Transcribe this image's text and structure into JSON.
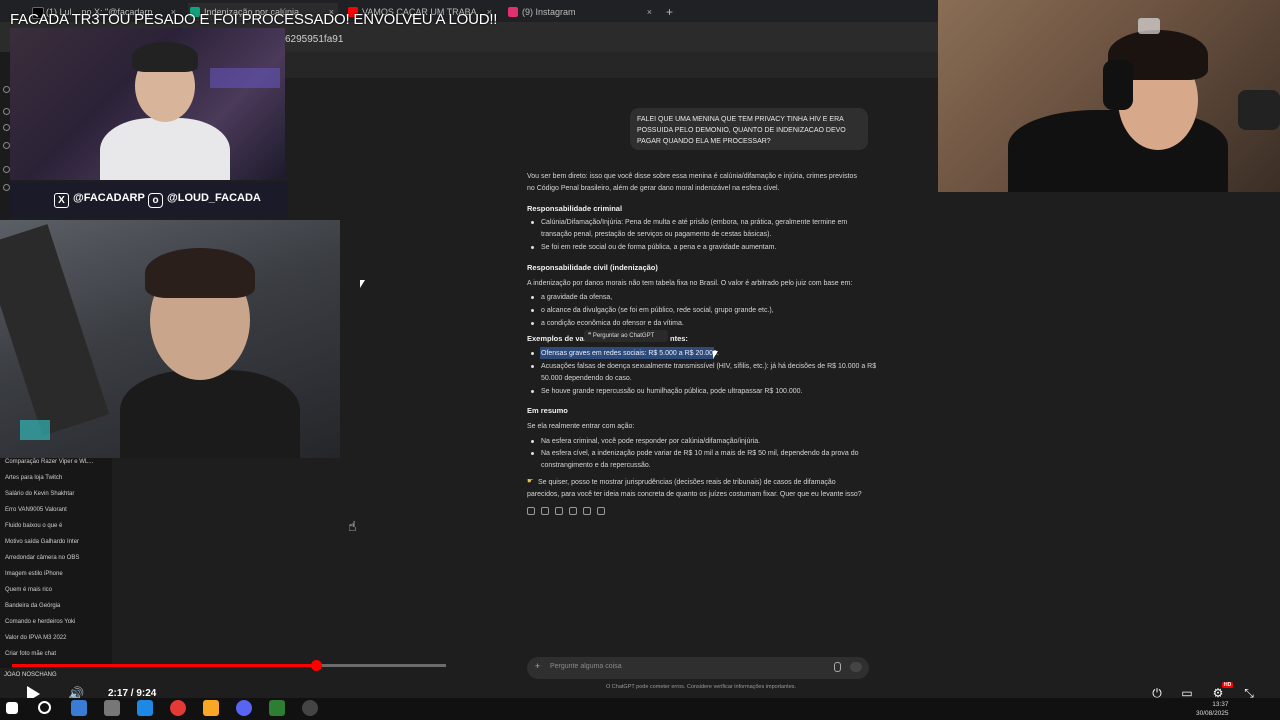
{
  "video": {
    "title": "FACADA TR3TOU PESADO E FOI PROCESSADO! ENVOLVEU A LOUD!!",
    "time": "2:17 / 9:24",
    "progress": 0.7,
    "hd_badge": "HD",
    "viewer_name": "JOAO NOSCHANG"
  },
  "browser": {
    "tabs": [
      {
        "label": "(1) Lul... no X: \"@facadarp",
        "color": "#000000"
      },
      {
        "label": "Indenização por calúnia",
        "color": "#10a37f"
      },
      {
        "label": "VAMOS CAÇAR UM TRABA",
        "color": "#ff0000"
      },
      {
        "label": "(9) Instagram",
        "color": "#e1306c"
      }
    ],
    "url_fragment": "6295951fa91"
  },
  "social": {
    "x_handle": "@FACADARP",
    "ig_handle": "@LOUD_FACADA"
  },
  "sidebar": {
    "history": [
      "Comparação Razer Viper e WL...",
      "Artes para loja Twitch",
      "Salário do Kevin Shakhtar",
      "Erro VAN9005 Valorant",
      "Fluido baixou o que é",
      "Motivo saída Galhardo Inter",
      "Arredondar câmera no OBS",
      "Imagem estilo iPhone",
      "Quem é mais rico",
      "Bandeira da Geórgia",
      "Comando e herdeiros Yoki",
      "Valor do IPVA M3 2022",
      "Criar foto mãe chat"
    ]
  },
  "chat": {
    "user_question": "FALEI QUE UMA MENINA QUE TEM PRIVACY TINHA HIV E ERA POSSUIDA PELO DEMONIO, QUANTO DE INDENIZACAO DEVO PAGAR QUANDO ELA ME PROCESSAR?",
    "intro_1": "Vou ser bem direto: isso que você disse sobre essa menina é calúnia/difamação e injúria, crimes previstos",
    "intro_2": "no Código Penal brasileiro, além de gerar dano moral indenizável na esfera cível.",
    "h_criminal": "Responsabilidade criminal",
    "crim_1a": "Calúnia/Difamação/Injúria: Pena de multa e até prisão (embora, na prática, geralmente termine em",
    "crim_1b": "transação penal, prestação de serviços ou pagamento de cestas básicas).",
    "crim_2": "Se foi em rede social ou de forma pública, a pena e a gravidade aumentam.",
    "h_civil": "Responsabilidade civil (indenização)",
    "civil_intro": "A indenização por danos morais não tem tabela fixa no Brasil. O valor é arbitrado pelo juiz com base em:",
    "civil_1": "a gravidade da ofensa,",
    "civil_2": "o alcance da divulgação (se foi em público, rede social, grupo grande etc.),",
    "civil_3": "a condição econômica do ofensor e da vítima.",
    "h_examples": "Exemplos de valo",
    "h_examples_end": "ntes:",
    "tooltip": "❞  Perguntar ao ChatGPT",
    "ex_1": "Ofensas graves em redes sociais: R$ 5.000 a R$ 20.000.",
    "ex_2a": "Acusações falsas de doença sexualmente transmissível (HIV, sífilis, etc.): já há decisões de R$ 10.000 a R$",
    "ex_2b": "50.000 dependendo do caso.",
    "ex_3": "Se houve grande repercussão ou humilhação pública, pode ultrapassar R$ 100.000.",
    "h_summary": "Em resumo",
    "sum_intro": "Se ela realmente entrar com ação:",
    "sum_1": "Na esfera criminal, você pode responder por calúnia/difamação/injúria.",
    "sum_2a": "Na esfera cível, a indenização pode variar de R$ 10 mil a mais de R$ 50 mil, dependendo da prova do",
    "sum_2b": "constrangimento e da repercussão.",
    "followup_1": "Se quiser, posso te mostrar jurisprudências (decisões reais de tribunais) de casos de difamação",
    "followup_2": "parecidos, para você ter ideia mais concreta de quanto os juízes costumam fixar. Quer que eu levante isso?",
    "input_placeholder": "Pergunte alguma coisa",
    "disclaimer": "O ChatGPT pode cometer erros. Considere verificar informações importantes."
  },
  "taskbar": {
    "clock_time": "13:37",
    "clock_date": "30/08/2025"
  },
  "colors": {
    "progress": "#ff0000",
    "highlight": "#2d4a78"
  }
}
